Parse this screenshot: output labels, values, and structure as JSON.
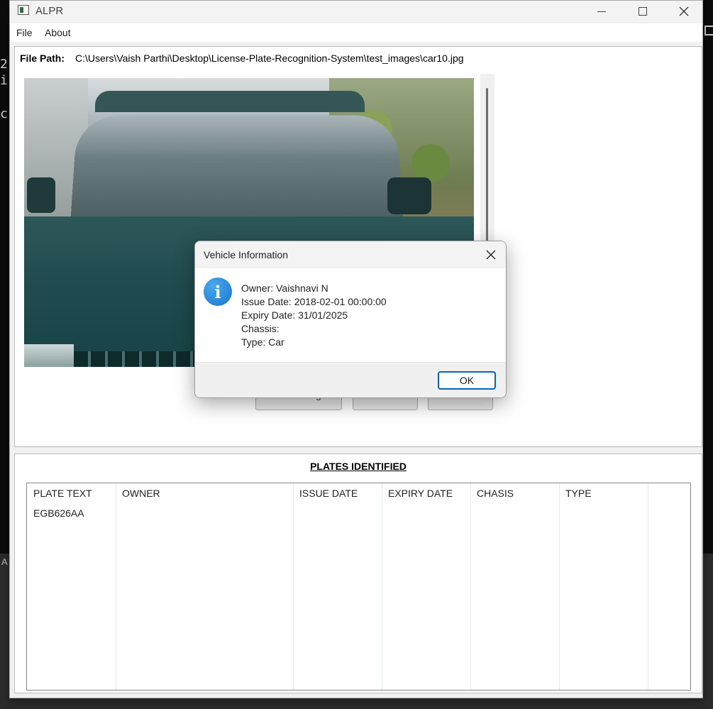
{
  "console": {
    "line1": "2",
    "line2": "i",
    "line3": "c",
    "footer": "A"
  },
  "window": {
    "title": "ALPR",
    "minimize_icon": "minimize-icon",
    "maximize_icon": "maximize-icon",
    "close_icon": "close-icon"
  },
  "menu": {
    "file": "File",
    "about": "About"
  },
  "file_path": {
    "label": "File Path:",
    "value": "C:\\Users\\Vaish Parthi\\Desktop\\License-Plate-Recognition-System\\test_images\\car10.jpg"
  },
  "buttons_behind_dialog": {
    "left_partial": "g"
  },
  "plates": {
    "title": "PLATES IDENTIFIED",
    "columns": [
      "PLATE TEXT",
      "OWNER",
      "ISSUE DATE",
      "EXPIRY DATE",
      "CHASIS",
      "TYPE"
    ],
    "rows": [
      [
        "EGB626AA",
        "",
        "",
        "",
        "",
        ""
      ]
    ]
  },
  "dialog": {
    "title": "Vehicle Information",
    "icon": "info-icon",
    "lines": [
      "Owner: Vaishnavi N",
      "Issue Date: 2018-02-01 00:00:00",
      "Expiry Date: 31/01/2025",
      "Chassis:",
      "Type: Car"
    ],
    "ok_label": "OK"
  },
  "colors": {
    "accent": "#0067c0",
    "info_icon": "#1976c9",
    "console_bg": "#0c0c0c"
  }
}
